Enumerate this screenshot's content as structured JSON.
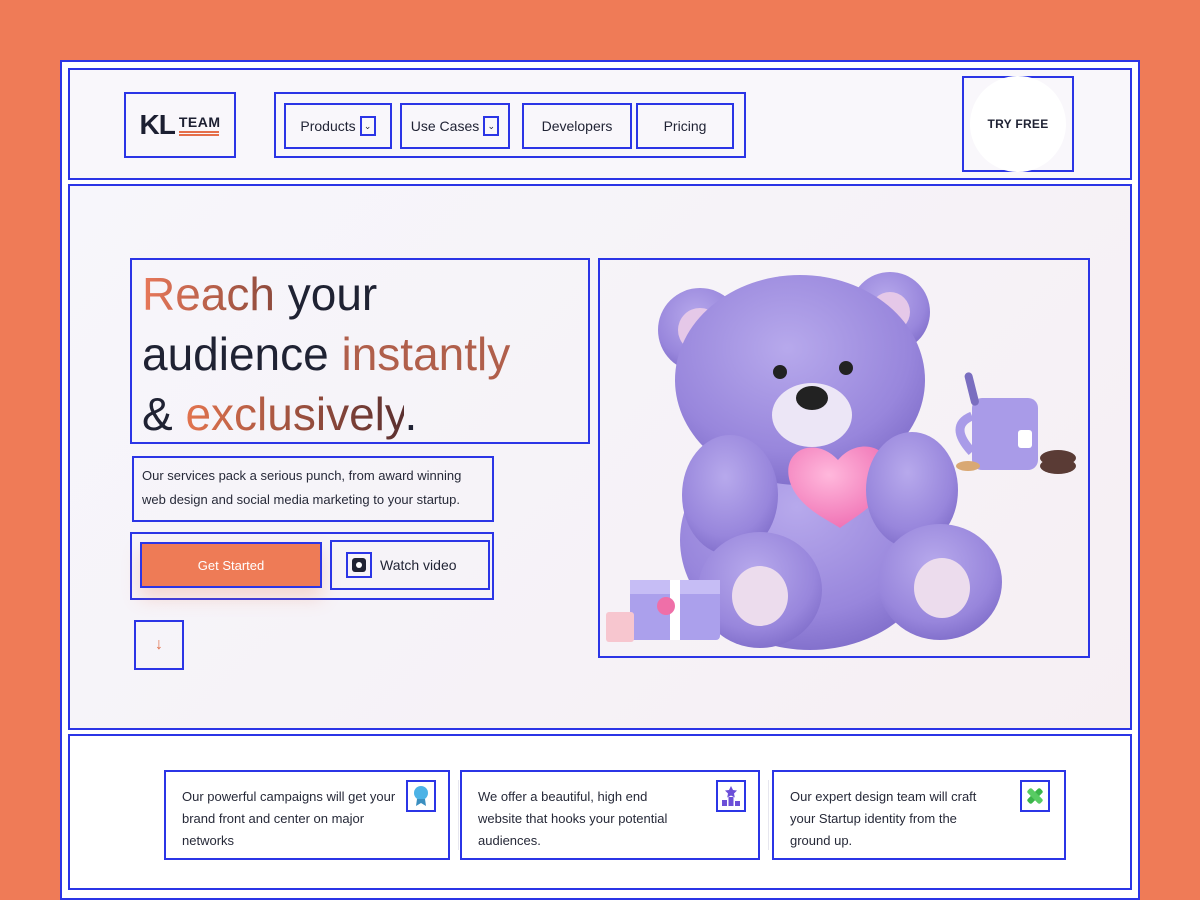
{
  "header": {
    "logo_main": "KL",
    "logo_sub": "TEAM",
    "nav": [
      {
        "label": "Products",
        "has_dropdown": true
      },
      {
        "label": "Use Cases",
        "has_dropdown": true
      },
      {
        "label": "Developers",
        "has_dropdown": false
      },
      {
        "label": "Pricing",
        "has_dropdown": false
      }
    ],
    "cta_label": "TRY FREE"
  },
  "hero": {
    "headline": {
      "part1": "Reach",
      "part2": " your",
      "part3": "audience ",
      "part4": "instantly",
      "part5": "& ",
      "part6": "exclusively",
      "part7": "."
    },
    "description": "Our services pack a serious punch, from award winning web design and social media marketing to your startup.",
    "primary_button": "Get Started",
    "video_button": "Watch video",
    "scroll_icon": "arrow-down-icon",
    "illustration": "teddy-bear-with-heart-illustration"
  },
  "features": [
    {
      "text": "Our powerful campaigns will get your brand front and center on major networks",
      "icon": "award-ribbon-icon",
      "icon_color": "#4cb3e6"
    },
    {
      "text": "We offer a beautiful, high end website that hooks your potential audiences.",
      "icon": "podium-star-icon",
      "icon_color": "#6c4fd8"
    },
    {
      "text": "Our expert design team will craft your Startup identity from the ground up.",
      "icon": "design-tools-icon",
      "icon_color": "#3bb54a"
    }
  ],
  "colors": {
    "background": "#ef7b57",
    "accent": "#ee7b56",
    "annotation_outline": "#2b35e6",
    "text": "#1f2233"
  }
}
